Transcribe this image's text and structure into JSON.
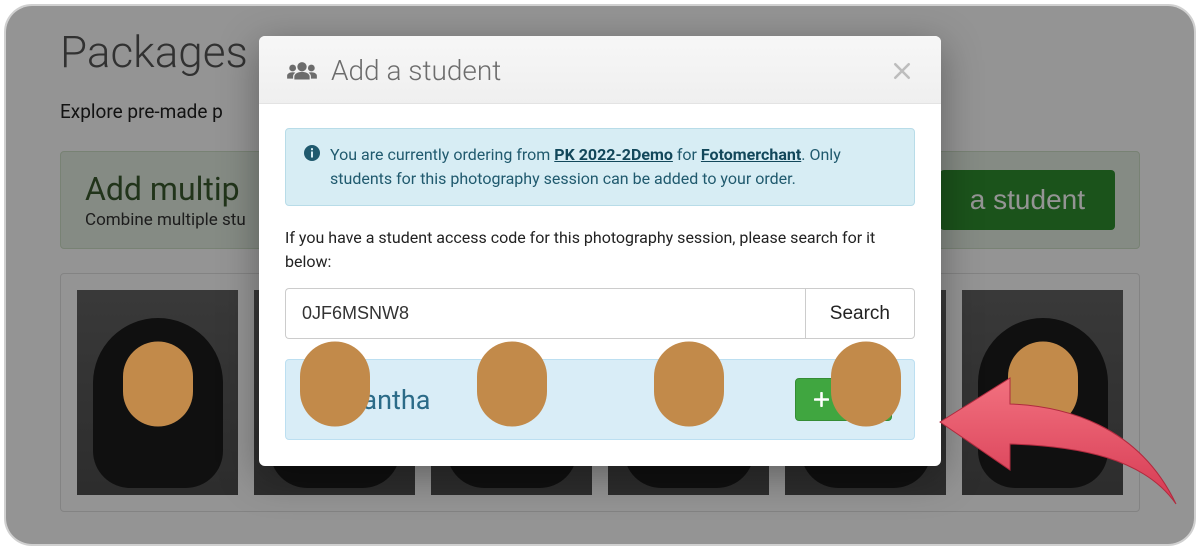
{
  "background": {
    "page_title": "Packages",
    "subtitle_fragment": "Explore pre-made p",
    "banner": {
      "title_fragment": "Add multip",
      "subtitle_fragment": "Combine multiple stu",
      "button_fragment": "a student"
    }
  },
  "modal": {
    "title": "Add a student",
    "info": {
      "pre": "You are currently ordering from ",
      "session_name": "PK 2022-2Demo",
      "mid": " for ",
      "merchant": "Fotomerchant",
      "post": ". Only students for this photography session can be added to your order."
    },
    "prompt": "If you have a student access code for this photography session, please search for it below:",
    "search": {
      "value": "0JF6MSNW8",
      "button": "Search"
    },
    "result": {
      "name": "Samantha",
      "add_label": "Add"
    }
  }
}
